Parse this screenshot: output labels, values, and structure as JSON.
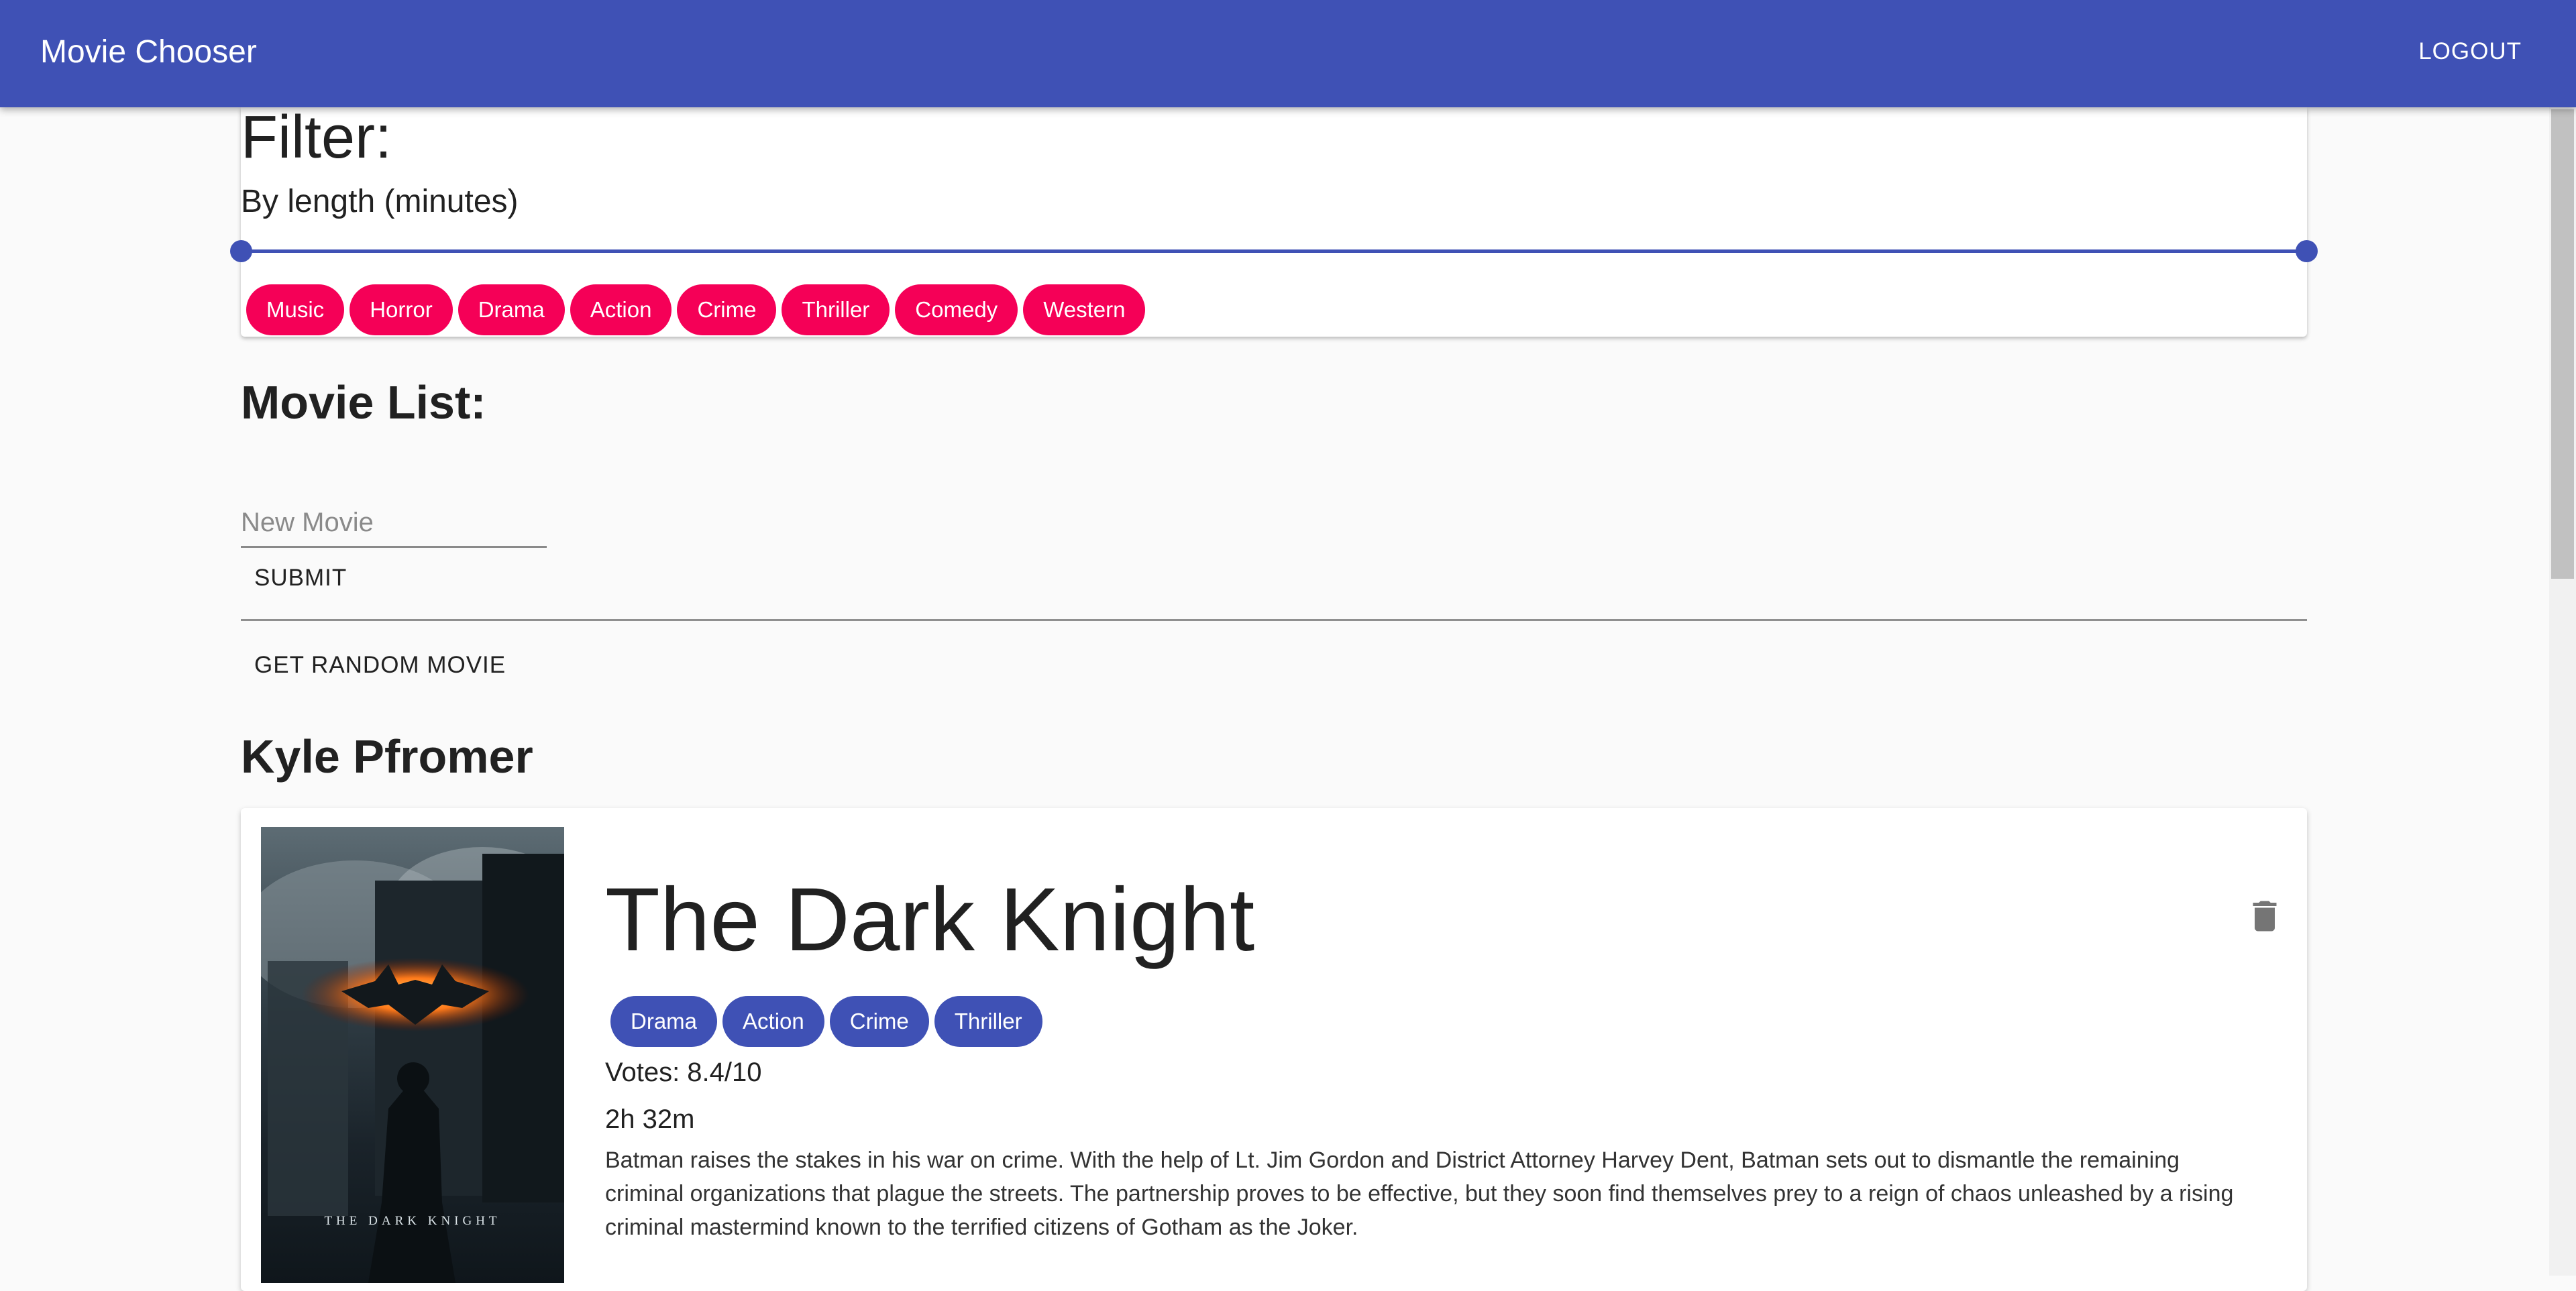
{
  "app": {
    "title": "Movie Chooser",
    "logout_label": "LOGOUT"
  },
  "filter": {
    "title": "Filter:",
    "length_label": "By length (minutes)",
    "genres": [
      "Music",
      "Horror",
      "Drama",
      "Action",
      "Crime",
      "Thriller",
      "Comedy",
      "Western"
    ]
  },
  "movie_list": {
    "title": "Movie List:",
    "new_movie_placeholder": "New Movie",
    "new_movie_value": "",
    "submit_label": "SUBMIT",
    "random_label": "GET RANDOM MOVIE"
  },
  "user": {
    "name": "Kyle Pfromer"
  },
  "movie": {
    "title": "The Dark Knight",
    "genres": [
      "Drama",
      "Action",
      "Crime",
      "Thriller"
    ],
    "votes": "Votes: 8.4/10",
    "runtime": "2h 32m",
    "overview": "Batman raises the stakes in his war on crime. With the help of Lt. Jim Gordon and District Attorney Harvey Dent, Batman sets out to dismantle the remaining criminal organizations that plague the streets. The partnership proves to be effective, but they soon find themselves prey to a reign of chaos unleashed by a rising criminal mastermind known to the terrified citizens of Gotham as the Joker.",
    "poster_logo_text": "THE DARK KNIGHT"
  },
  "colors": {
    "primary": "#3f51b5",
    "accent": "#f50057",
    "background": "#fafafa"
  },
  "icons": {
    "delete": "trash-icon"
  }
}
